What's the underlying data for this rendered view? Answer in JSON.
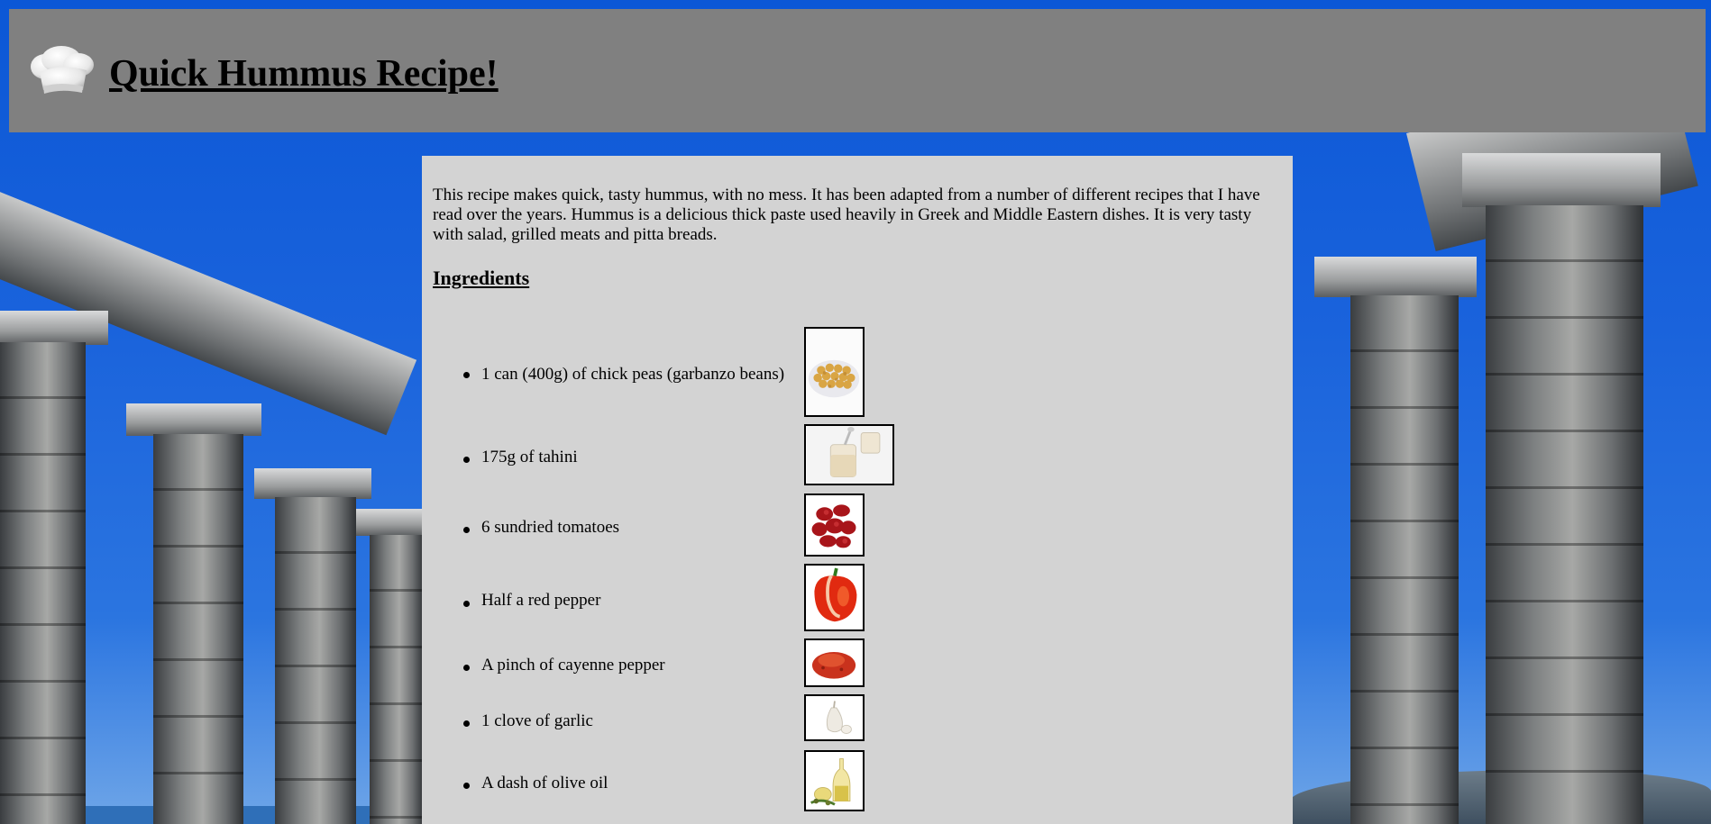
{
  "header": {
    "title": "Quick Hummus Recipe!",
    "logo_icon": "chef-hat-icon",
    "background_color": "#808080"
  },
  "panel": {
    "background_color": "#d3d3d3",
    "intro": "This recipe makes quick, tasty hummus, with no mess. It has been adapted from a number of different recipes that I have read over the years. Hummus is a delicious thick paste used heavily in Greek and Middle Eastern dishes. It is very tasty with salad, grilled meats and pitta breads.",
    "ingredients_heading": "Ingredients",
    "ingredients": [
      {
        "label": "1 can (400g) of chick peas (garbanzo beans)",
        "image_icon": "chickpeas-photo-icon"
      },
      {
        "label": "175g of tahini",
        "image_icon": "tahini-photo-icon"
      },
      {
        "label": "6 sundried tomatoes",
        "image_icon": "sundried-tomatoes-photo-icon"
      },
      {
        "label": "Half a red pepper",
        "image_icon": "red-pepper-photo-icon"
      },
      {
        "label": "A pinch of cayenne pepper",
        "image_icon": "cayenne-pepper-photo-icon"
      },
      {
        "label": "1 clove of garlic",
        "image_icon": "garlic-photo-icon"
      },
      {
        "label": "A dash of olive oil",
        "image_icon": "olive-oil-photo-icon"
      }
    ]
  },
  "background": {
    "scene_icon": "temple-columns-photo",
    "sky_color": "#0b57d6"
  }
}
